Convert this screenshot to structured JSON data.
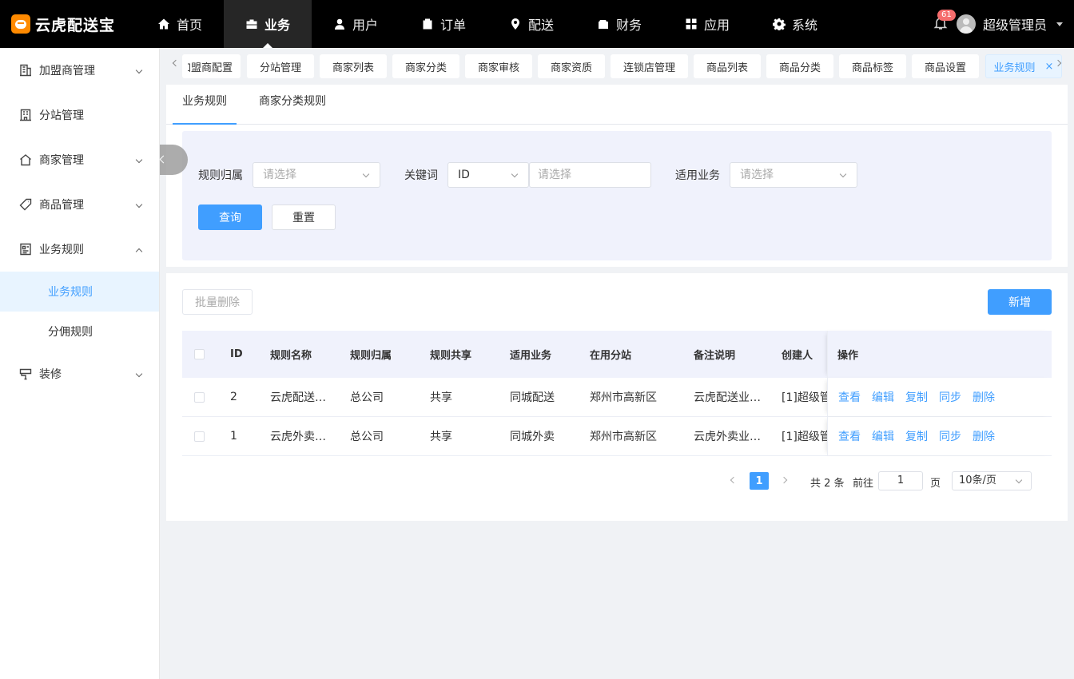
{
  "app": {
    "logo_text": "云虎配送宝"
  },
  "topnav": [
    {
      "label": "首页",
      "icon": "home-icon"
    },
    {
      "label": "业务",
      "icon": "briefcase-icon",
      "active": true
    },
    {
      "label": "用户",
      "icon": "user-icon"
    },
    {
      "label": "订单",
      "icon": "clipboard-icon"
    },
    {
      "label": "配送",
      "icon": "location-pin-icon"
    },
    {
      "label": "财务",
      "icon": "wallet-icon"
    },
    {
      "label": "应用",
      "icon": "grid-icon"
    },
    {
      "label": "系统",
      "icon": "gear-icon"
    }
  ],
  "header": {
    "notification_count": "61",
    "admin_name": "超级管理员"
  },
  "sidebar": {
    "items": [
      {
        "label": "加盟商管理",
        "icon": "building-icon"
      },
      {
        "label": "分站管理",
        "icon": "office-icon"
      },
      {
        "label": "商家管理",
        "icon": "house-icon"
      },
      {
        "label": "商品管理",
        "icon": "tag-icon"
      },
      {
        "label": "业务规则",
        "icon": "rules-icon",
        "expanded": true
      },
      {
        "label": "装修",
        "icon": "decor-icon"
      }
    ],
    "sub_items": [
      {
        "label": "业务规则",
        "active": true
      },
      {
        "label": "分佣规则"
      }
    ]
  },
  "tabs": [
    "加盟商配置",
    "分站管理",
    "商家列表",
    "商家分类",
    "商家审核",
    "商家资质",
    "连锁店管理",
    "商品列表",
    "商品分类",
    "商品标签",
    "商品设置",
    "业务规则"
  ],
  "tabs_close": "×",
  "subtabs": [
    "业务规则",
    "商家分类规则"
  ],
  "filters": {
    "rule_owner_label": "规则归属",
    "rule_owner_placeholder": "请选择",
    "keyword_label": "关键词",
    "keyword_type_value": "ID",
    "keyword_placeholder": "请选择",
    "business_label": "适用业务",
    "business_placeholder": "请选择",
    "query_button": "查询",
    "reset_button": "重置"
  },
  "toolbar": {
    "batch_delete": "批量删除",
    "add_new": "新增"
  },
  "table": {
    "columns": [
      "ID",
      "规则名称",
      "规则归属",
      "规则共享",
      "适用业务",
      "在用分站",
      "备注说明",
      "创建人",
      "操作"
    ],
    "rows": [
      {
        "id": "2",
        "name": "云虎配送…",
        "owner": "总公司",
        "share": "共享",
        "business": "同城配送",
        "station": "郑州市高新区",
        "remark": "云虎配送业…",
        "creator": "[1]超级管"
      },
      {
        "id": "1",
        "name": "云虎外卖…",
        "owner": "总公司",
        "share": "共享",
        "business": "同城外卖",
        "station": "郑州市高新区",
        "remark": "云虎外卖业…",
        "creator": "[1]超级管"
      }
    ],
    "actions": [
      "查看",
      "编辑",
      "复制",
      "同步",
      "删除"
    ]
  },
  "pagination": {
    "current_page": "1",
    "total_text": "共 2 条",
    "goto_label": "前往",
    "goto_value": "1",
    "page_unit": "页",
    "page_size": "10条/页"
  },
  "colors": {
    "primary": "#409eff",
    "topbar": "#000000",
    "badge": "#f56c6c",
    "filter_bg": "#f0f2fc"
  }
}
